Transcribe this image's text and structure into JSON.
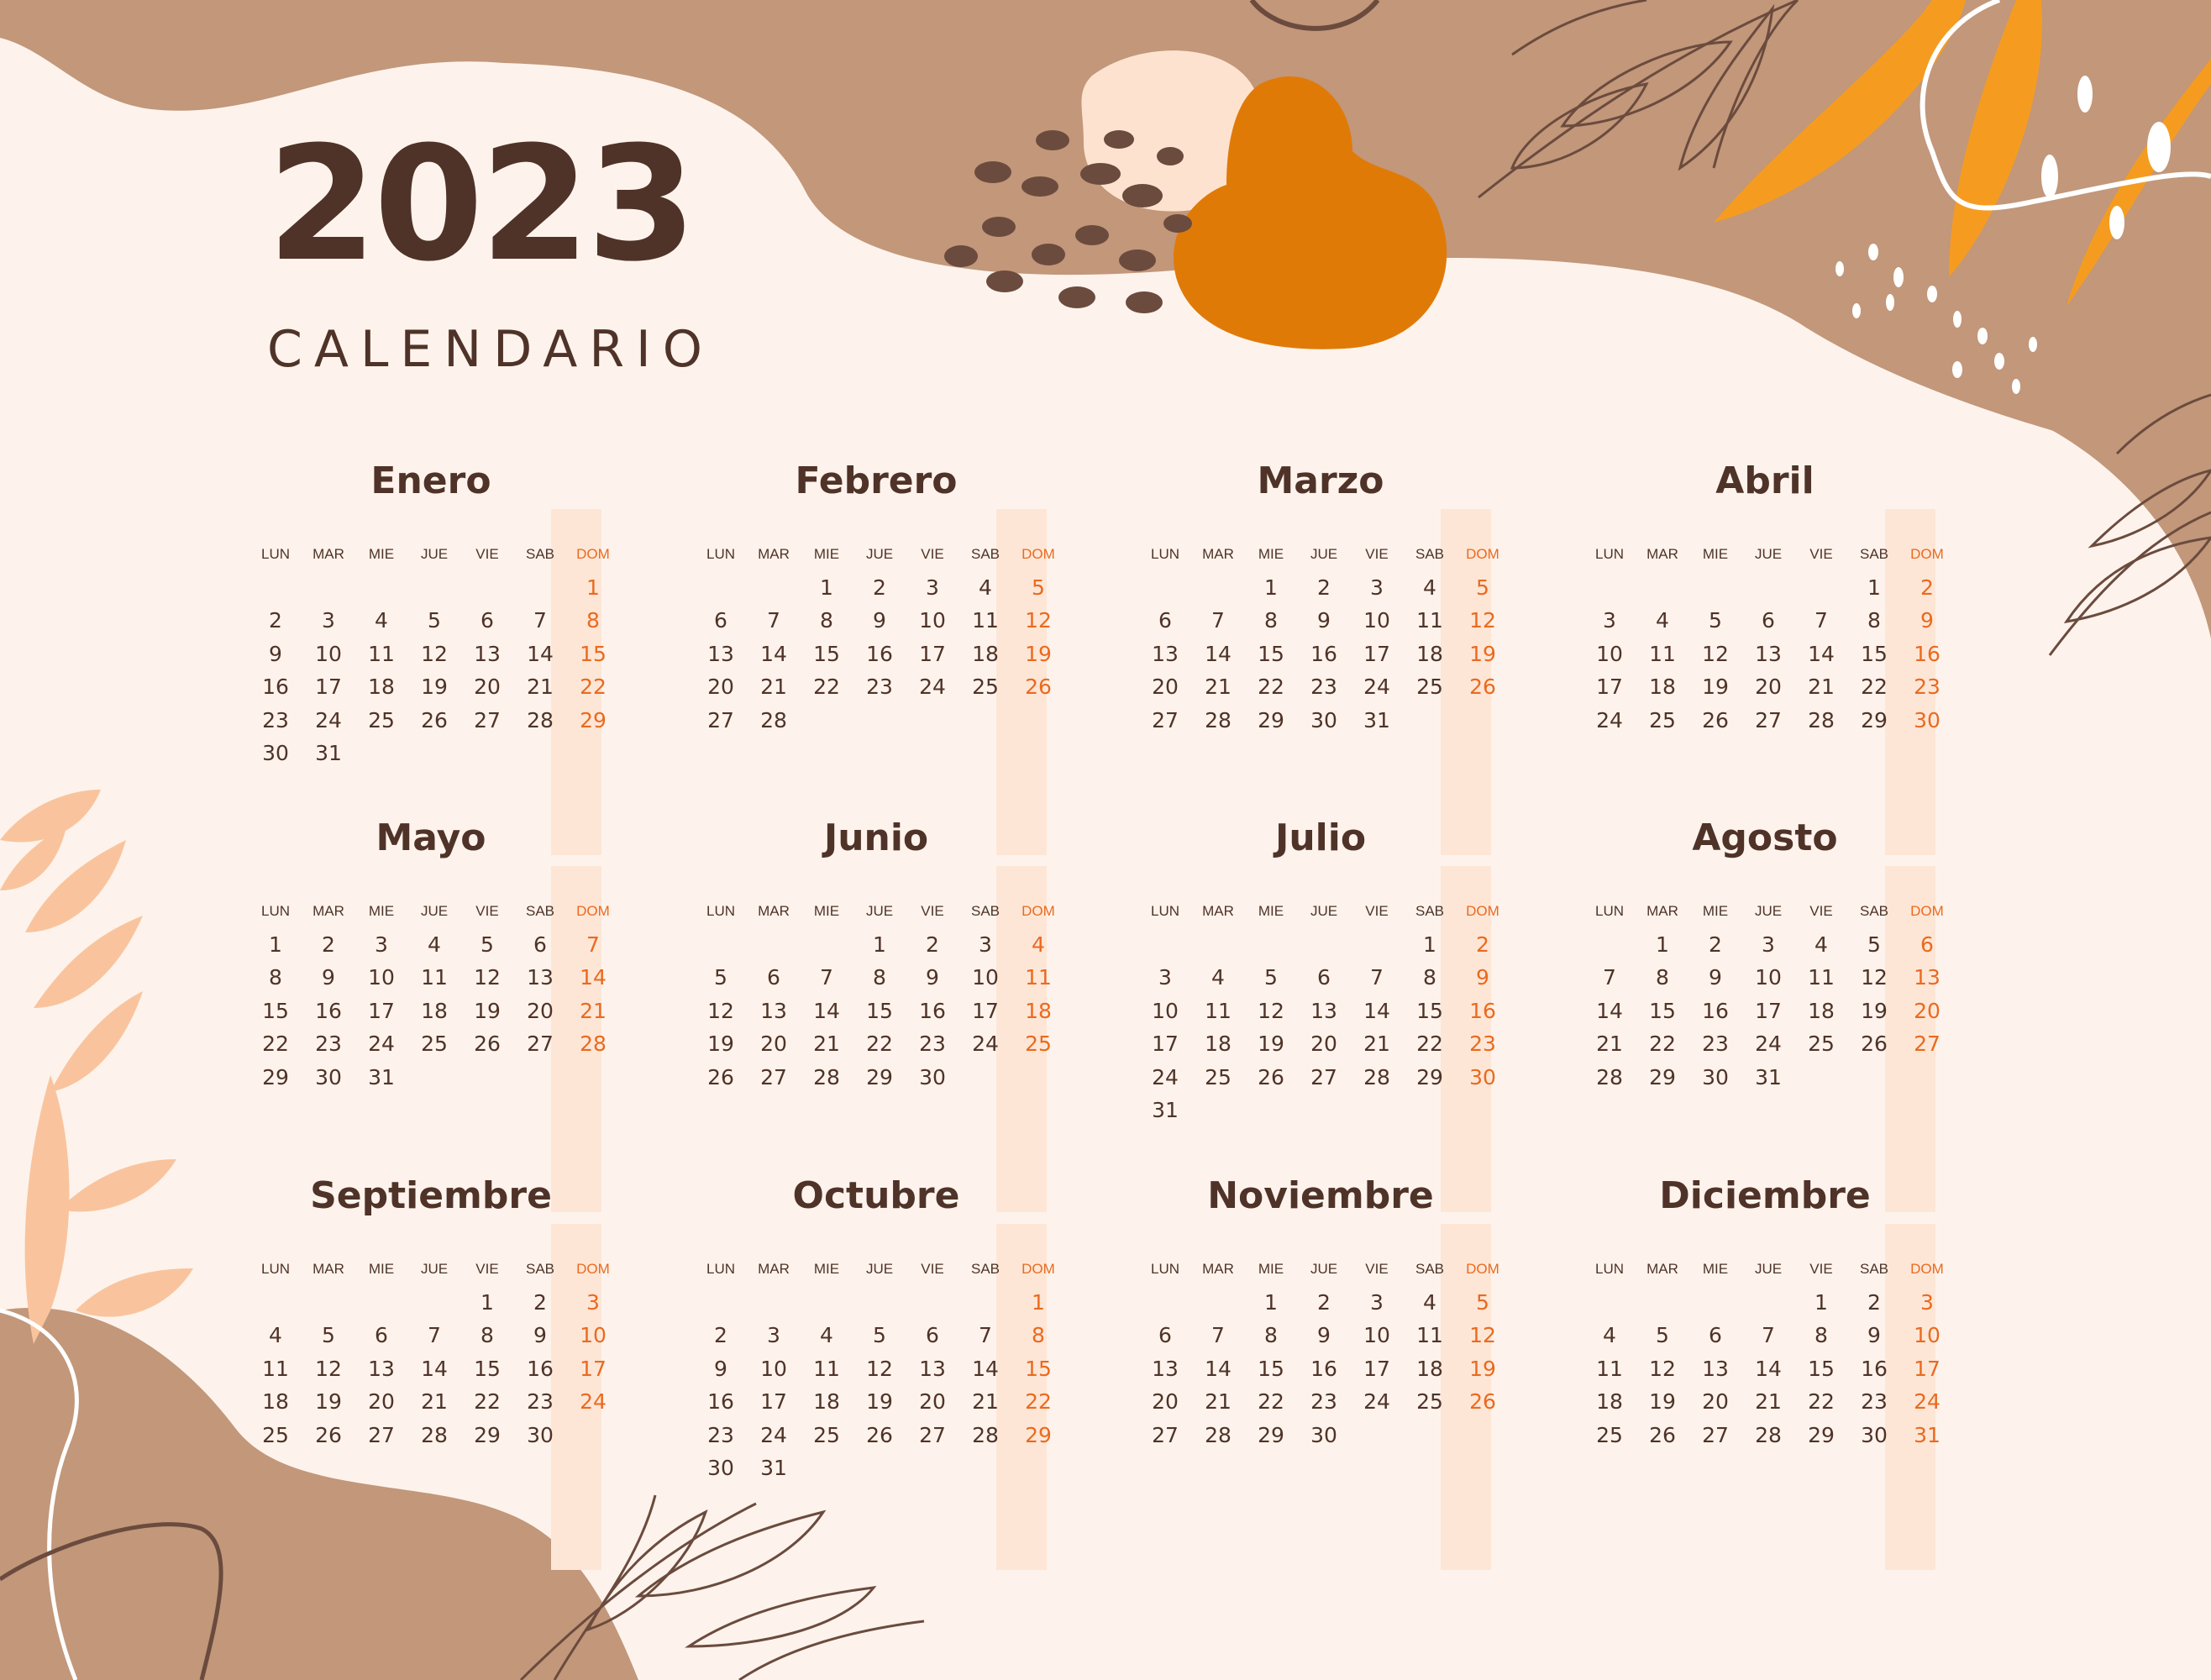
{
  "title": {
    "year": "2023",
    "subtitle": "CALENDARIO"
  },
  "colors": {
    "background": "#fdf3ec",
    "text": "#4f3328",
    "sunday": "#ea6a1f",
    "sunday_band": "#fde6d6",
    "shape_tan": "#c2977a",
    "shape_peach": "#fde3cf",
    "shape_orange": "#e07a07",
    "leaf_orange": "#f59c20",
    "leaf_peach": "#f9c49d",
    "line_brown": "#6b4b3e"
  },
  "weekdays": [
    "LUN",
    "MAR",
    "MIE",
    "JUE",
    "VIE",
    "SAB",
    "DOM"
  ],
  "months": [
    {
      "name": "Enero",
      "start": 6,
      "days": 31
    },
    {
      "name": "Febrero",
      "start": 2,
      "days": 28
    },
    {
      "name": "Marzo",
      "start": 2,
      "days": 31
    },
    {
      "name": "Abril",
      "start": 5,
      "days": 30
    },
    {
      "name": "Mayo",
      "start": 0,
      "days": 31
    },
    {
      "name": "Junio",
      "start": 3,
      "days": 30
    },
    {
      "name": "Julio",
      "start": 5,
      "days": 31
    },
    {
      "name": "Agosto",
      "start": 1,
      "days": 31
    },
    {
      "name": "Septiembre",
      "start": 4,
      "days": 30
    },
    {
      "name": "Octubre",
      "start": 6,
      "days": 31
    },
    {
      "name": "Noviembre",
      "start": 2,
      "days": 30
    },
    {
      "name": "Diciembre",
      "start": 4,
      "days": 31
    }
  ]
}
